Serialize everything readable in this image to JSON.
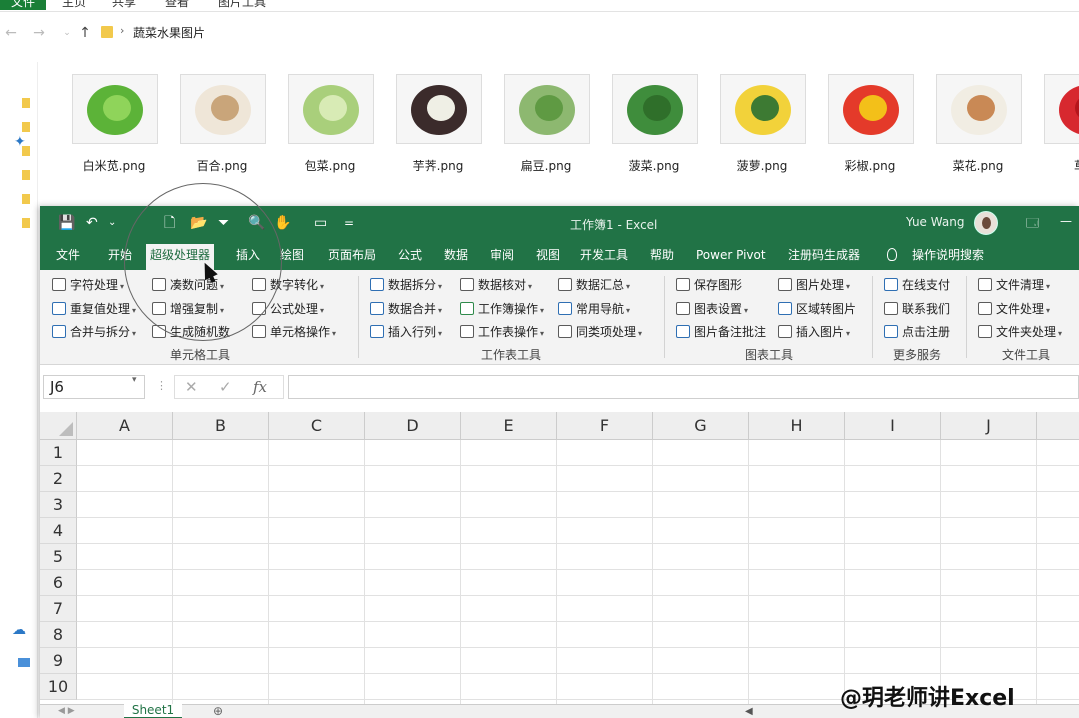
{
  "explorer": {
    "ribbon_tabs": [
      "文件",
      "主页",
      "共享",
      "查看",
      "图片工具"
    ],
    "breadcrumb": "蔬菜水果图片",
    "files": [
      {
        "name": "白米苋.png",
        "colors": [
          "#5cb338",
          "#8fd45a"
        ]
      },
      {
        "name": "百合.png",
        "colors": [
          "#efe6d8",
          "#c9a57a"
        ]
      },
      {
        "name": "包菜.png",
        "colors": [
          "#a9cf7b",
          "#d8ebb5"
        ]
      },
      {
        "name": "芋荠.png",
        "colors": [
          "#3b2b2b",
          "#efefe5"
        ]
      },
      {
        "name": "扁豆.png",
        "colors": [
          "#8db870",
          "#5f9a43"
        ]
      },
      {
        "name": "菠菜.png",
        "colors": [
          "#3f8d3c",
          "#2f6f2a"
        ]
      },
      {
        "name": "菠萝.png",
        "colors": [
          "#f2d23a",
          "#3d7a33"
        ]
      },
      {
        "name": "彩椒.png",
        "colors": [
          "#e43a2a",
          "#f3c019"
        ]
      },
      {
        "name": "菜花.png",
        "colors": [
          "#f1ede3",
          "#c98955"
        ]
      },
      {
        "name": "草莓",
        "colors": [
          "#d7282f",
          "#b5151c"
        ]
      }
    ]
  },
  "excel": {
    "quick_access": [
      "💾",
      "↶",
      "⌄",
      "🗋",
      "📂",
      "⏷",
      "🔍",
      "✋",
      "▭",
      "="
    ],
    "title": "工作簿1  -  Excel",
    "user": "Yue Wang",
    "window_buttons": [
      "🗔",
      "—"
    ],
    "tabs": [
      "文件",
      "开始",
      "超级处理器",
      "插入",
      "绘图",
      "页面布局",
      "公式",
      "数据",
      "审阅",
      "视图",
      "开发工具",
      "帮助",
      "Power Pivot",
      "注册码生成器",
      "操作说明搜索"
    ],
    "active_tab": "超级处理器",
    "ribbon_groups": [
      {
        "label": "单元格工具",
        "items": [
          "字符处理",
          "重复值处理",
          "合并与拆分",
          "凑数问题",
          "增强复制",
          "生成随机数",
          "数字转化",
          "公式处理",
          "单元格操作"
        ]
      },
      {
        "label": "工作表工具",
        "items": [
          "数据拆分",
          "数据合并",
          "插入行列",
          "数据核对",
          "工作簿操作",
          "工作表操作",
          "数据汇总",
          "常用导航",
          "同类项处理"
        ]
      },
      {
        "label": "图表工具",
        "items": [
          "保存图形",
          "图表设置",
          "图片备注批注",
          "图片处理",
          "区域转图片",
          "插入图片"
        ]
      },
      {
        "label": "更多服务",
        "items": [
          "在线支付",
          "联系我们",
          "点击注册"
        ]
      },
      {
        "label": "文件工具",
        "items": [
          "文件清理",
          "文件处理",
          "文件夹处理"
        ]
      }
    ],
    "name_box": "J6",
    "formula_buttons": [
      "✕",
      "✓",
      "fx"
    ],
    "columns": [
      "A",
      "B",
      "C",
      "D",
      "E",
      "F",
      "G",
      "H",
      "I",
      "J"
    ],
    "rows": [
      "1",
      "2",
      "3",
      "4",
      "5",
      "6",
      "7",
      "8",
      "9",
      "10"
    ],
    "sheet_tab": "Sheet1"
  },
  "watermark": "@玥老师讲Excel"
}
